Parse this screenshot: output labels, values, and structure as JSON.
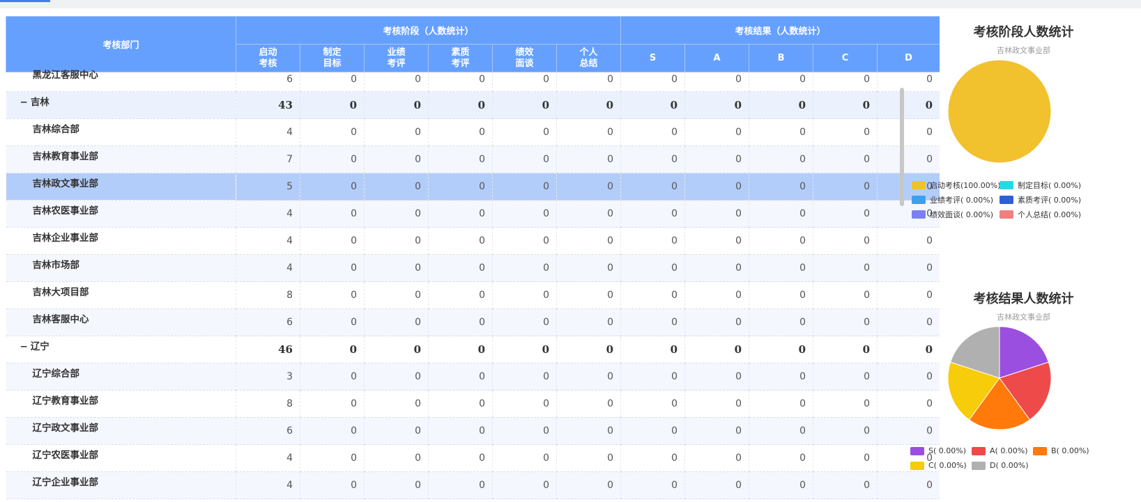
{
  "table": {
    "header": {
      "dept": "考核部门",
      "stage_group": "考核阶段（人数统计）",
      "result_group": "考核结果（人数统计）",
      "stage_cols": [
        [
          "启动",
          "考核"
        ],
        [
          "制定",
          "目标"
        ],
        [
          "业绩",
          "考评"
        ],
        [
          "素质",
          "考评"
        ],
        [
          "绩效",
          "面谈"
        ],
        [
          "个人",
          "总结"
        ]
      ],
      "result_cols": [
        "S",
        "A",
        "B",
        "C",
        "D"
      ]
    },
    "rows": [
      {
        "name": "黑龙江客服中心",
        "type": "child",
        "values": [
          "6",
          "0",
          "0",
          "0",
          "0",
          "0",
          "0",
          "0",
          "0",
          "0",
          "0"
        ]
      },
      {
        "name": "吉林",
        "type": "group",
        "values": [
          "43",
          "0",
          "0",
          "0",
          "0",
          "0",
          "0",
          "0",
          "0",
          "0",
          "0"
        ]
      },
      {
        "name": "吉林综合部",
        "type": "child",
        "values": [
          "4",
          "0",
          "0",
          "0",
          "0",
          "0",
          "0",
          "0",
          "0",
          "0",
          "0"
        ]
      },
      {
        "name": "吉林教育事业部",
        "type": "child",
        "values": [
          "7",
          "0",
          "0",
          "0",
          "0",
          "0",
          "0",
          "0",
          "0",
          "0",
          "0"
        ]
      },
      {
        "name": "吉林政文事业部",
        "type": "child",
        "selected": true,
        "values": [
          "5",
          "0",
          "0",
          "0",
          "0",
          "0",
          "0",
          "0",
          "0",
          "0",
          "0"
        ]
      },
      {
        "name": "吉林农医事业部",
        "type": "child",
        "values": [
          "4",
          "0",
          "0",
          "0",
          "0",
          "0",
          "0",
          "0",
          "0",
          "0",
          "0"
        ]
      },
      {
        "name": "吉林企业事业部",
        "type": "child",
        "values": [
          "4",
          "0",
          "0",
          "0",
          "0",
          "0",
          "0",
          "0",
          "0",
          "0",
          "0"
        ]
      },
      {
        "name": "吉林市场部",
        "type": "child",
        "values": [
          "4",
          "0",
          "0",
          "0",
          "0",
          "0",
          "0",
          "0",
          "0",
          "0",
          "0"
        ]
      },
      {
        "name": "吉林大项目部",
        "type": "child",
        "values": [
          "8",
          "0",
          "0",
          "0",
          "0",
          "0",
          "0",
          "0",
          "0",
          "0",
          "0"
        ]
      },
      {
        "name": "吉林客服中心",
        "type": "child",
        "values": [
          "6",
          "0",
          "0",
          "0",
          "0",
          "0",
          "0",
          "0",
          "0",
          "0",
          "0"
        ]
      },
      {
        "name": "辽宁",
        "type": "group",
        "values": [
          "46",
          "0",
          "0",
          "0",
          "0",
          "0",
          "0",
          "0",
          "0",
          "0",
          "0"
        ]
      },
      {
        "name": "辽宁综合部",
        "type": "child",
        "values": [
          "3",
          "0",
          "0",
          "0",
          "0",
          "0",
          "0",
          "0",
          "0",
          "0",
          "0"
        ]
      },
      {
        "name": "辽宁教育事业部",
        "type": "child",
        "values": [
          "8",
          "0",
          "0",
          "0",
          "0",
          "0",
          "0",
          "0",
          "0",
          "0",
          "0"
        ]
      },
      {
        "name": "辽宁政文事业部",
        "type": "child",
        "values": [
          "6",
          "0",
          "0",
          "0",
          "0",
          "0",
          "0",
          "0",
          "0",
          "0",
          "0"
        ]
      },
      {
        "name": "辽宁农医事业部",
        "type": "child",
        "values": [
          "4",
          "0",
          "0",
          "0",
          "0",
          "0",
          "0",
          "0",
          "0",
          "0",
          "0"
        ]
      },
      {
        "name": "辽宁企业事业部",
        "type": "child",
        "values": [
          "4",
          "0",
          "0",
          "0",
          "0",
          "0",
          "0",
          "0",
          "0",
          "0",
          "0"
        ]
      }
    ],
    "collapse_symbol": "−"
  },
  "charts": {
    "stage": {
      "title": "考核阶段人数统计",
      "subtitle": "吉林政文事业部",
      "legend": [
        {
          "label": "启动考核(100.00%)",
          "color": "#f2c12e"
        },
        {
          "label": "制定目标( 0.00%)",
          "color": "#26d9e6"
        },
        {
          "label": "业绩考评( 0.00%)",
          "color": "#3ba0f0"
        },
        {
          "label": "素质考评( 0.00%)",
          "color": "#2f5fd4"
        },
        {
          "label": "绩效面谈( 0.00%)",
          "color": "#7b7ff5"
        },
        {
          "label": "个人总结( 0.00%)",
          "color": "#f08080"
        }
      ]
    },
    "result": {
      "title": "考核结果人数统计",
      "subtitle": "吉林政文事业部",
      "legend": [
        {
          "label": "S( 0.00%)",
          "color": "#9b4fe0"
        },
        {
          "label": "A( 0.00%)",
          "color": "#ee4a4a"
        },
        {
          "label": "B( 0.00%)",
          "color": "#ff7a0a"
        },
        {
          "label": "C( 0.00%)",
          "color": "#f7cc0a"
        },
        {
          "label": "D( 0.00%)",
          "color": "#b0b0b0"
        }
      ]
    }
  },
  "chart_data": [
    {
      "type": "pie",
      "title": "考核阶段人数统计",
      "subtitle": "吉林政文事业部",
      "categories": [
        "启动考核",
        "制定目标",
        "业绩考评",
        "素质考评",
        "绩效面谈",
        "个人总结"
      ],
      "values": [
        5,
        0,
        0,
        0,
        0,
        0
      ],
      "colors": [
        "#f2c12e",
        "#26d9e6",
        "#3ba0f0",
        "#2f5fd4",
        "#7b7ff5",
        "#f08080"
      ],
      "legend_position": "bottom"
    },
    {
      "type": "pie",
      "title": "考核结果人数统计",
      "subtitle": "吉林政文事业部",
      "categories": [
        "S",
        "A",
        "B",
        "C",
        "D"
      ],
      "values": [
        0,
        0,
        0,
        0,
        0
      ],
      "colors": [
        "#9b4fe0",
        "#ee4a4a",
        "#ff7a0a",
        "#f7cc0a",
        "#b0b0b0"
      ],
      "legend_position": "bottom"
    }
  ]
}
